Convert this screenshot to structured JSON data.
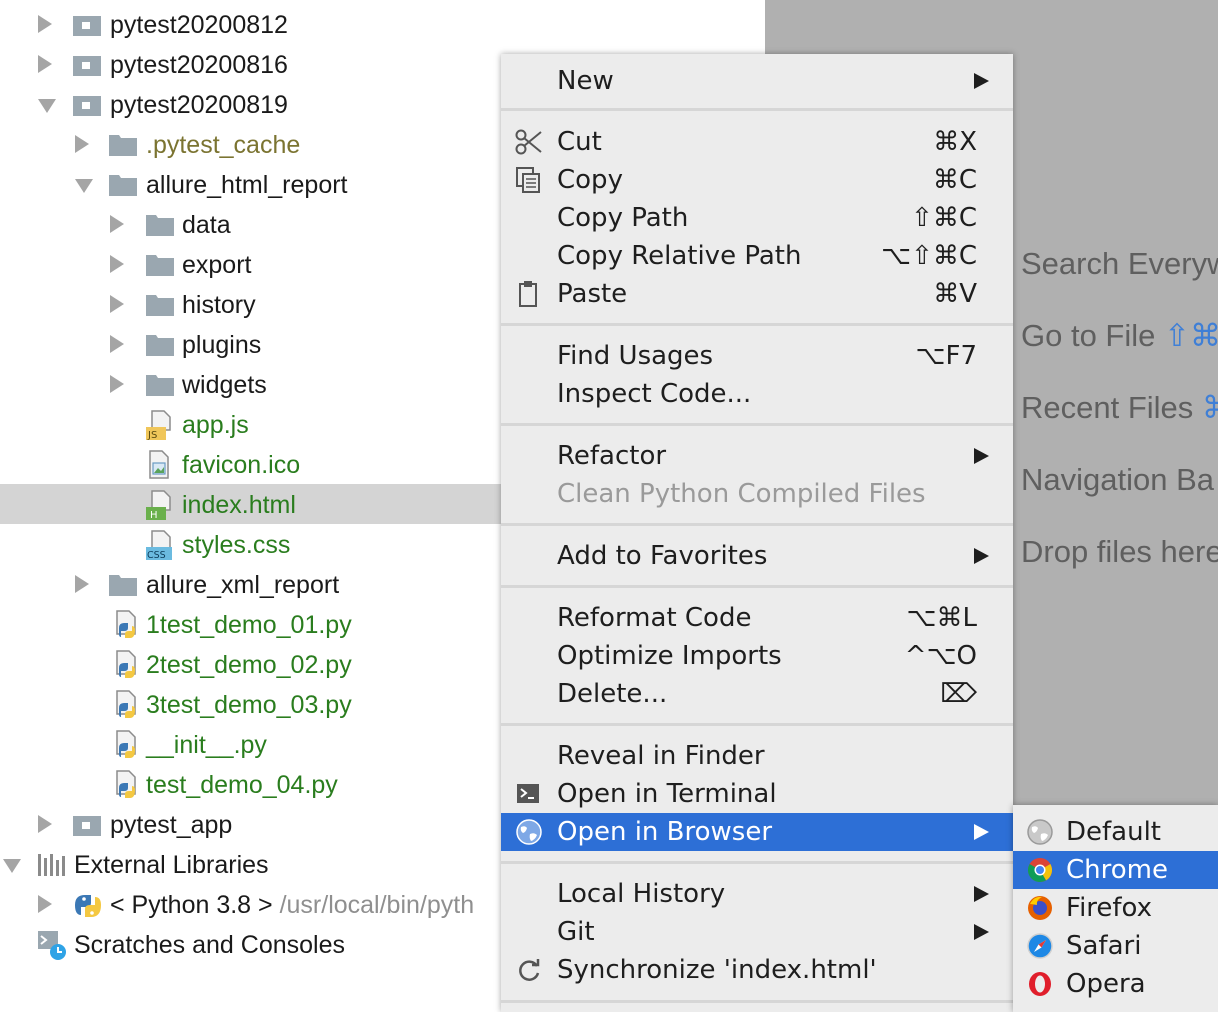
{
  "tree": {
    "items": [
      {
        "label": "pytest20200812"
      },
      {
        "label": "pytest20200816"
      },
      {
        "label": "pytest20200819"
      },
      {
        "label": ".pytest_cache"
      },
      {
        "label": "allure_html_report"
      },
      {
        "label": "data"
      },
      {
        "label": "export"
      },
      {
        "label": "history"
      },
      {
        "label": "plugins"
      },
      {
        "label": "widgets"
      },
      {
        "label": "app.js"
      },
      {
        "label": "favicon.ico"
      },
      {
        "label": "index.html"
      },
      {
        "label": "styles.css"
      },
      {
        "label": "allure_xml_report"
      },
      {
        "label": "1test_demo_01.py"
      },
      {
        "label": "2test_demo_02.py"
      },
      {
        "label": "3test_demo_03.py"
      },
      {
        "label": "__init__.py"
      },
      {
        "label": "test_demo_04.py"
      },
      {
        "label": "pytest_app"
      },
      {
        "label": "External Libraries"
      },
      {
        "label": "< Python 3.8 >",
        "path": "/usr/local/bin/pyth"
      },
      {
        "label": "Scratches and Consoles"
      }
    ],
    "file_badges": {
      "js": "JS",
      "html": "H",
      "css": "CSS"
    }
  },
  "editor": {
    "hints": [
      {
        "text": "Search Everyw",
        "key": ""
      },
      {
        "text": "Go to File",
        "key": "⇧⌘"
      },
      {
        "text": "Recent Files",
        "key": "⌘"
      },
      {
        "text": "Navigation Ba",
        "key": ""
      },
      {
        "text": "Drop files here",
        "key": ""
      }
    ]
  },
  "menu": {
    "items": [
      {
        "label": "New",
        "shortcut": ""
      },
      {
        "label": "Cut",
        "shortcut": "⌘X"
      },
      {
        "label": "Copy",
        "shortcut": "⌘C"
      },
      {
        "label": "Copy Path",
        "shortcut": "⇧⌘C"
      },
      {
        "label": "Copy Relative Path",
        "shortcut": "⌥⇧⌘C"
      },
      {
        "label": "Paste",
        "shortcut": "⌘V"
      },
      {
        "label": "Find Usages",
        "shortcut": "⌥F7"
      },
      {
        "label": "Inspect Code...",
        "shortcut": ""
      },
      {
        "label": "Refactor",
        "shortcut": ""
      },
      {
        "label": "Clean Python Compiled Files",
        "shortcut": ""
      },
      {
        "label": "Add to Favorites",
        "shortcut": ""
      },
      {
        "label": "Reformat Code",
        "shortcut": "⌥⌘L"
      },
      {
        "label": "Optimize Imports",
        "shortcut": "^⌥O"
      },
      {
        "label": "Delete...",
        "shortcut": "⌦"
      },
      {
        "label": "Reveal in Finder",
        "shortcut": ""
      },
      {
        "label": "Open in Terminal",
        "shortcut": ""
      },
      {
        "label": "Open in Browser",
        "shortcut": ""
      },
      {
        "label": "Local History",
        "shortcut": ""
      },
      {
        "label": "Git",
        "shortcut": ""
      },
      {
        "label": "Synchronize 'index.html'",
        "shortcut": ""
      }
    ]
  },
  "browser_submenu": {
    "items": [
      {
        "label": "Default"
      },
      {
        "label": "Chrome"
      },
      {
        "label": "Firefox"
      },
      {
        "label": "Safari"
      },
      {
        "label": "Opera"
      }
    ]
  },
  "colors": {
    "selection_blue": "#2d6fd6",
    "menu_background": "#ececec",
    "vcs_added_green": "#2a7d1e",
    "excluded_olive": "#7b7431",
    "editor_gray": "#b0b0b0"
  }
}
